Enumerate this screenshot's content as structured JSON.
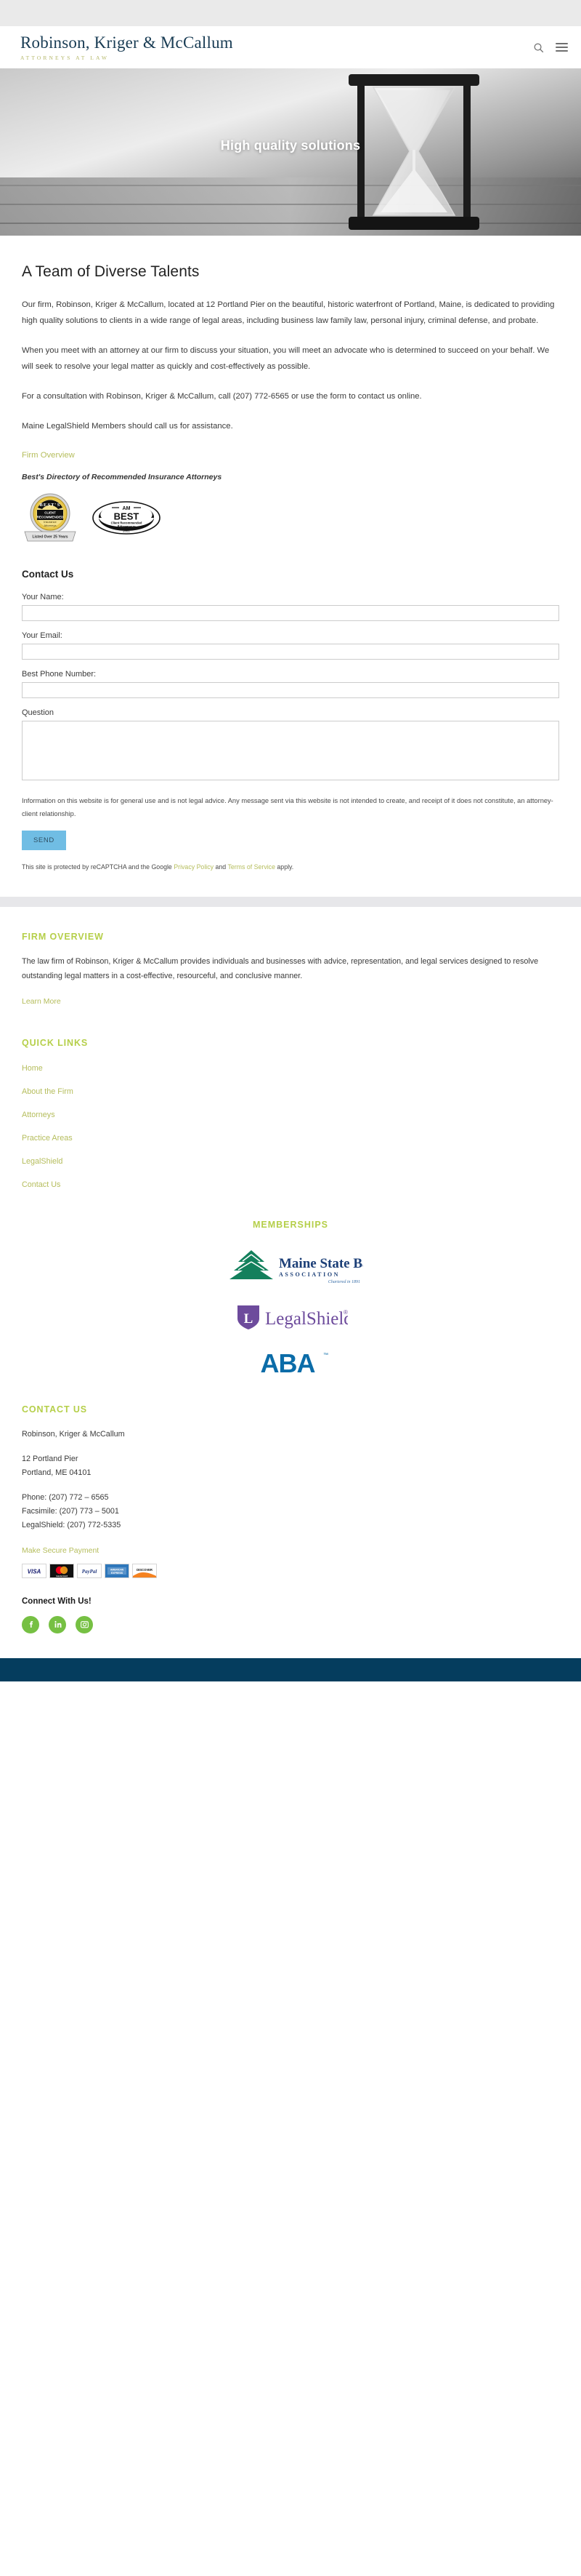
{
  "header": {
    "brand_name": "Robinson, Kriger & McCallum",
    "brand_tagline": "ATTORNEYS AT LAW",
    "search_icon": "search-icon",
    "menu_icon": "hamburger-menu-icon"
  },
  "hero": {
    "title": "High quality solutions"
  },
  "main": {
    "page_title": "A Team of Diverse Talents",
    "paragraphs": [
      "Our firm, Robinson, Kriger & McCallum, located at 12 Portland Pier on the beautiful, historic waterfront of Portland, Maine, is dedicated to providing high quality solutions to clients in a wide range of legal areas, including business law family law, personal injury, criminal defense, and probate.",
      "When you meet with an attorney at our firm to discuss your situation, you will meet an advocate who is determined to succeed on your behalf. We will seek to resolve your legal matter as quickly and cost-effectively as possible.",
      "For a consultation with Robinson, Kriger & McCallum, call (207) 772-6565 or use the form to contact us online.",
      "Maine LegalShield Members should call us for assistance."
    ],
    "firm_overview_link": "Firm Overview",
    "bests_caption": "Best's Directory of Recommended Insurance Attorneys",
    "badges": [
      {
        "name": "bests-client-recommended-badge",
        "line1": "BEST'S",
        "line2": "CLIENT",
        "line3": "RECOMMENDED",
        "line4": "Insurance",
        "line5": "Attorneys",
        "ribbon": "Listed Over 25 Years"
      },
      {
        "name": "am-best-badge",
        "line1": "AM",
        "line2": "BEST",
        "line3": "Client Recommended",
        "line4": "Attorneys",
        "line5": "2021"
      }
    ]
  },
  "form": {
    "title": "Contact Us",
    "fields": [
      {
        "label": "Your Name:",
        "value": "",
        "placeholder": "",
        "type": "text",
        "name": "your-name-input"
      },
      {
        "label": "Your Email:",
        "value": "",
        "placeholder": "",
        "type": "text",
        "name": "your-email-input"
      },
      {
        "label": "Best Phone Number:",
        "value": "",
        "placeholder": "",
        "type": "text",
        "name": "best-phone-number-input"
      }
    ],
    "question_label": "Question",
    "question_value": "",
    "question_placeholder": "",
    "disclaimer": "Information on this website is for general use and is not legal advice. Any message sent via this website is not intended to create, and receipt of it does not constitute, an attorney-client relationship.",
    "send_label": "SEND",
    "send_color": "#70bde4",
    "recaptcha": {
      "prefix": "This site is protected by reCAPTCHA and the Google ",
      "privacy_link": "Privacy Policy",
      "middle": " and ",
      "terms_link": "Terms of Service",
      "suffix": " apply."
    }
  },
  "footer": {
    "accent_color": "#b5cf49",
    "firm_overview": {
      "heading": "FIRM OVERVIEW",
      "body": "The law firm of Robinson, Kriger & McCallum provides individuals and businesses with advice, representation, and legal services designed to resolve outstanding legal matters in a cost-effective, resourceful, and conclusive manner.",
      "link": "Learn More"
    },
    "quick_links": {
      "heading": "QUICK LINKS",
      "items": [
        "Home",
        "About the Firm",
        "Attorneys",
        "Practice Areas",
        "LegalShield",
        "Contact Us"
      ]
    },
    "memberships": {
      "heading": "MEMBERSHIPS",
      "logos": [
        {
          "name": "maine-state-bar-association-logo",
          "line1": "Maine State Bar",
          "line2": "A S S O C I A T I O N",
          "line3": "Chartered in 1891"
        },
        {
          "name": "legalshield-logo",
          "line1": "LegalShield"
        },
        {
          "name": "american-bar-association-logo",
          "line1": "ABA"
        }
      ]
    },
    "contact": {
      "heading": "CONTACT US",
      "firm_name": "Robinson, Kriger & McCallum",
      "address_line1": "12 Portland Pier",
      "address_line2": "Portland, ME 04101",
      "phone": "Phone: (207) 772 – 6565",
      "facsimile": "Facsimile: (207) 773 – 5001",
      "legalshield": "LegalShield: (207) 772-5335",
      "payment_link": "Make Secure Payment",
      "payment_methods": [
        {
          "name": "visa-card-icon",
          "label": "VISA"
        },
        {
          "name": "mastercard-card-icon",
          "label": "MC"
        },
        {
          "name": "paypal-card-icon",
          "label": "PayPal"
        },
        {
          "name": "amex-card-icon",
          "label": "AMEX"
        },
        {
          "name": "discover-card-icon",
          "label": "DISCOVER"
        }
      ],
      "connect_heading": "Connect With Us!",
      "social": [
        {
          "name": "facebook-icon",
          "glyph": "f"
        },
        {
          "name": "linkedin-icon",
          "glyph": "in"
        },
        {
          "name": "instagram-icon",
          "glyph": "▣"
        }
      ],
      "social_color": "#76c043"
    }
  }
}
